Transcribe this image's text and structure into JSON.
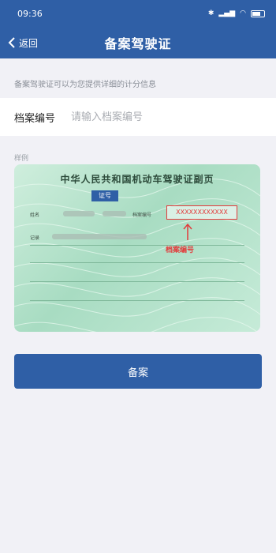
{
  "status_bar": {
    "time": "09:36",
    "icons": [
      "bluetooth-icon",
      "signal-icon",
      "wifi-icon",
      "battery-icon"
    ]
  },
  "nav": {
    "back_label": "返回",
    "title": "备案驾驶证"
  },
  "hint_text": "备案驾驶证可以为您提供详细的计分信息",
  "form": {
    "field_label": "档案编号",
    "placeholder": "请输入档案编号",
    "value": ""
  },
  "sample": {
    "label": "样例",
    "card_title": "中华人民共和国机动车驾驶证副页",
    "card_badge": "证号",
    "name_label": "姓名",
    "file_no_label": "档案编号",
    "record_label": "记录",
    "sample_value": "XXXXXXXXXXXX",
    "annotation": "档案编号"
  },
  "submit_label": "备案",
  "colors": {
    "primary": "#2f5fa6",
    "highlight": "#e23b3b"
  }
}
